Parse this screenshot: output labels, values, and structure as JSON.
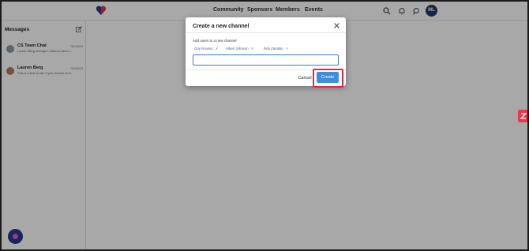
{
  "nav": {
    "items": [
      "Community",
      "Sponsors",
      "Members",
      "Events"
    ],
    "user_initials": "ML",
    "icons": [
      "search-icon",
      "bell-icon",
      "chat-icon"
    ]
  },
  "sidebar": {
    "title": "Messages",
    "conversations": [
      {
        "name": "CS Team Chat",
        "date": "06/13/23",
        "preview": "Lauren Berg changed channel name t..."
      },
      {
        "name": "Lauren Berg",
        "date": "06/28/23",
        "preview": "This is a test to see if you receive an e..."
      }
    ]
  },
  "modal": {
    "title": "Create a new channel",
    "label": "Add users to a new channel",
    "selected_users": [
      "Guy Rousso",
      "Albert Johnson",
      "Rob Zambito"
    ],
    "input_value": "",
    "cancel_label": "Cancel",
    "create_label": "Create"
  },
  "colors": {
    "accent": "#3c8fdc",
    "highlight": "#e3264f",
    "avatar": "#1d3a67",
    "side_tab": "#e8384f"
  }
}
